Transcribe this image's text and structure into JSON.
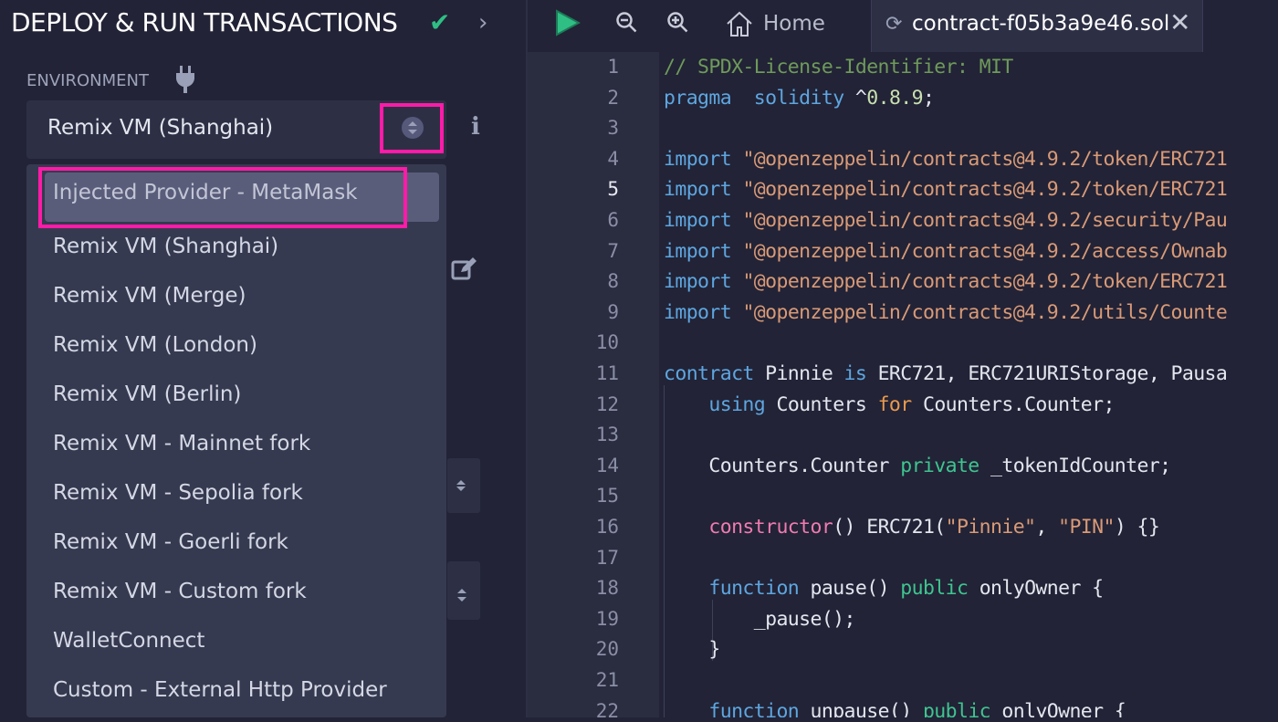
{
  "sidebar": {
    "title": "DEPLOY & RUN TRANSACTIONS",
    "environment_label": "ENVIRONMENT",
    "selected_environment": "Remix VM (Shanghai)",
    "options": [
      "Injected Provider - MetaMask",
      "Remix VM (Shanghai)",
      "Remix VM (Merge)",
      "Remix VM (London)",
      "Remix VM (Berlin)",
      "Remix VM - Mainnet fork",
      "Remix VM - Sepolia fork",
      "Remix VM - Goerli fork",
      "Remix VM - Custom fork",
      "WalletConnect",
      "Custom - External Http Provider"
    ],
    "highlight_color": "#ff1ba8"
  },
  "tabs": {
    "home": "Home",
    "file": "contract-f05b3a9e46.sol"
  },
  "editor": {
    "current_line": 5,
    "lines": [
      [
        [
          "com",
          "// SPDX-License-Identifier: MIT"
        ]
      ],
      [
        [
          "kw",
          "pragma"
        ],
        [
          "",
          "  "
        ],
        [
          "kw",
          "solidity"
        ],
        [
          "",
          " ^"
        ],
        [
          "num",
          "0.8.9"
        ],
        [
          "",
          ";"
        ]
      ],
      [],
      [
        [
          "kw",
          "import"
        ],
        [
          "",
          " "
        ],
        [
          "str",
          "\"@openzeppelin/contracts@4.9.2/token/ERC721"
        ]
      ],
      [
        [
          "kw",
          "import"
        ],
        [
          "",
          " "
        ],
        [
          "str",
          "\"@openzeppelin/contracts@4.9.2/token/ERC721"
        ]
      ],
      [
        [
          "kw",
          "import"
        ],
        [
          "",
          " "
        ],
        [
          "str",
          "\"@openzeppelin/contracts@4.9.2/security/Pau"
        ]
      ],
      [
        [
          "kw",
          "import"
        ],
        [
          "",
          " "
        ],
        [
          "str",
          "\"@openzeppelin/contracts@4.9.2/access/Ownab"
        ]
      ],
      [
        [
          "kw",
          "import"
        ],
        [
          "",
          " "
        ],
        [
          "str",
          "\"@openzeppelin/contracts@4.9.2/token/ERC721"
        ]
      ],
      [
        [
          "kw",
          "import"
        ],
        [
          "",
          " "
        ],
        [
          "str",
          "\"@openzeppelin/contracts@4.9.2/utils/Counte"
        ]
      ],
      [],
      [
        [
          "kw",
          "contract"
        ],
        [
          "",
          " Pinnie "
        ],
        [
          "kw",
          "is"
        ],
        [
          "",
          " ERC721, ERC721URIStorage, Pausa"
        ]
      ],
      [
        [
          "",
          "    "
        ],
        [
          "kw",
          "using"
        ],
        [
          "",
          " Counters "
        ],
        [
          "or",
          "for"
        ],
        [
          "",
          " Counters.Counter;"
        ]
      ],
      [],
      [
        [
          "",
          "    Counters.Counter "
        ],
        [
          "grn",
          "private"
        ],
        [
          "",
          " _tokenIdCounter;"
        ]
      ],
      [],
      [
        [
          "",
          "    "
        ],
        [
          "pink",
          "constructor"
        ],
        [
          "",
          "() ERC721("
        ],
        [
          "str",
          "\"Pinnie\""
        ],
        [
          "",
          ", "
        ],
        [
          "str",
          "\"PIN\""
        ],
        [
          "",
          ") {}"
        ]
      ],
      [],
      [
        [
          "",
          "    "
        ],
        [
          "kw",
          "function"
        ],
        [
          "",
          " pause() "
        ],
        [
          "grn",
          "public"
        ],
        [
          "",
          " onlyOwner {"
        ]
      ],
      [
        [
          "",
          "        _pause();"
        ]
      ],
      [
        [
          "",
          "    }"
        ]
      ],
      [],
      [
        [
          "",
          "    "
        ],
        [
          "kw",
          "function"
        ],
        [
          "",
          " unpause() "
        ],
        [
          "grn",
          "public"
        ],
        [
          "",
          " onlyOwner {"
        ]
      ]
    ]
  }
}
